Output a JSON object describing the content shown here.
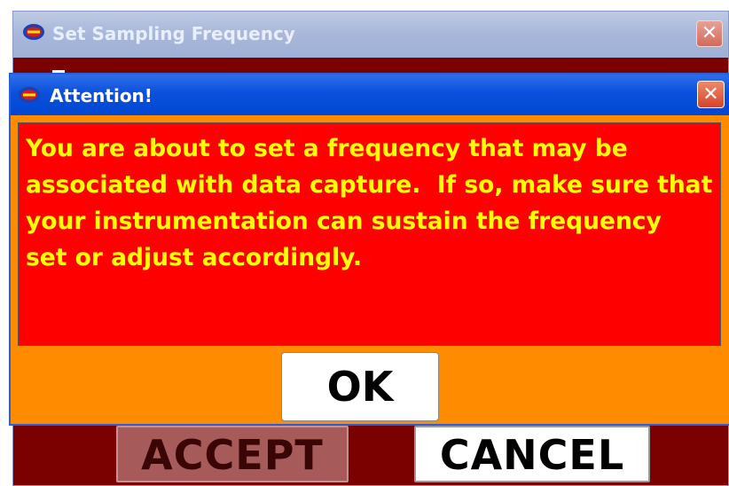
{
  "background_window": {
    "title": "Set Sampling Frequency",
    "close_label": "✕",
    "accept_label": "ACCEPT",
    "cancel_label": "CANCEL"
  },
  "dialog": {
    "title": "Attention!",
    "close_label": "✕",
    "message": "You are about to set a frequency that may be associated with data capture.  If so, make sure that your instrumentation can sustain the frequency  set or adjust accordingly.",
    "ok_label": "OK"
  },
  "colors": {
    "dialog_body": "#ff8c00",
    "message_panel": "#ff0000",
    "message_text": "#ffff00",
    "background_window_body": "#7b0000"
  },
  "icons": [
    "app-logo-icon",
    "close-icon"
  ]
}
